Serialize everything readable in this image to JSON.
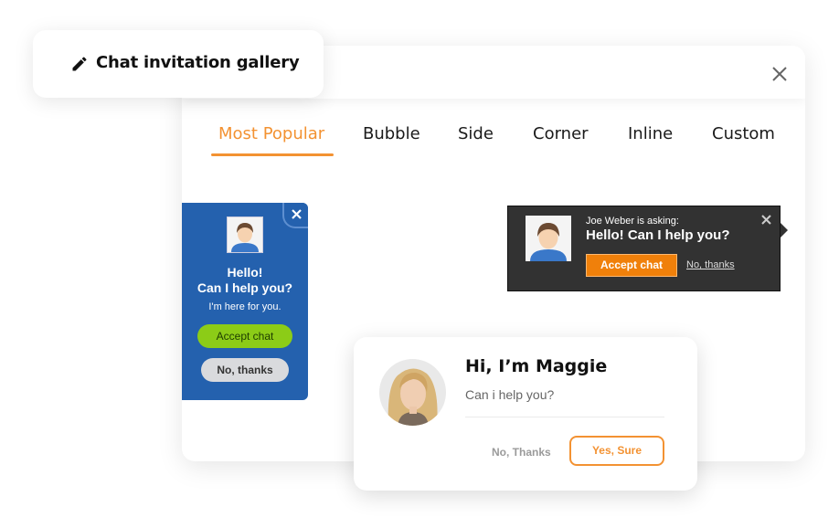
{
  "title_card": {
    "title": "Chat invitation gallery",
    "icon": "pencil-icon"
  },
  "panel": {
    "close_icon": "close-icon"
  },
  "tabs": [
    {
      "label": "Most Popular",
      "active": true
    },
    {
      "label": "Bubble",
      "active": false
    },
    {
      "label": "Side",
      "active": false
    },
    {
      "label": "Corner",
      "active": false
    },
    {
      "label": "Inline",
      "active": false
    },
    {
      "label": "Custom",
      "active": false
    }
  ],
  "blue_bubble": {
    "heading_line1": "Hello!",
    "heading_line2": "Can I help you?",
    "subtext": "I'm here for you.",
    "accept_label": "Accept chat",
    "decline_label": "No, thanks"
  },
  "dark_popup": {
    "asker": "Joe Weber is asking:",
    "message": "Hello! Can I help you?",
    "accept_label": "Accept chat",
    "decline_label": "No, thanks"
  },
  "maggie_card": {
    "heading": "Hi, I’m Maggie",
    "subtext": "Can i help you?",
    "decline_label": "No, Thanks",
    "accept_label": "Yes, Sure"
  },
  "colors": {
    "accent": "#f39232",
    "blue_bubble": "#2461ae",
    "lime_button": "#8ccc17",
    "dark_popup": "#323232",
    "orange_button": "#f0800a"
  }
}
